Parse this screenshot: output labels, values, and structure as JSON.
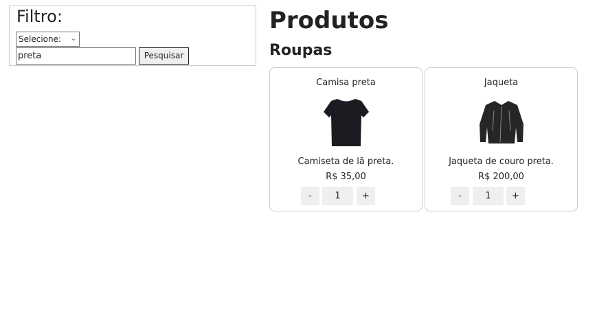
{
  "filter": {
    "title": "Filtro:",
    "select_value": "Selecione:",
    "search_value": "preta",
    "search_button": "Pesquisar"
  },
  "main": {
    "title": "Produtos",
    "category": "Roupas",
    "products": [
      {
        "name": "Camisa preta",
        "description": "Camiseta de lã preta.",
        "price": "R$ 35,00",
        "quantity": "1",
        "minus": "-",
        "plus": "+"
      },
      {
        "name": "Jaqueta",
        "description": "Jaqueta de couro preta.",
        "price": "R$ 200,00",
        "quantity": "1",
        "minus": "-",
        "plus": "+"
      }
    ]
  }
}
